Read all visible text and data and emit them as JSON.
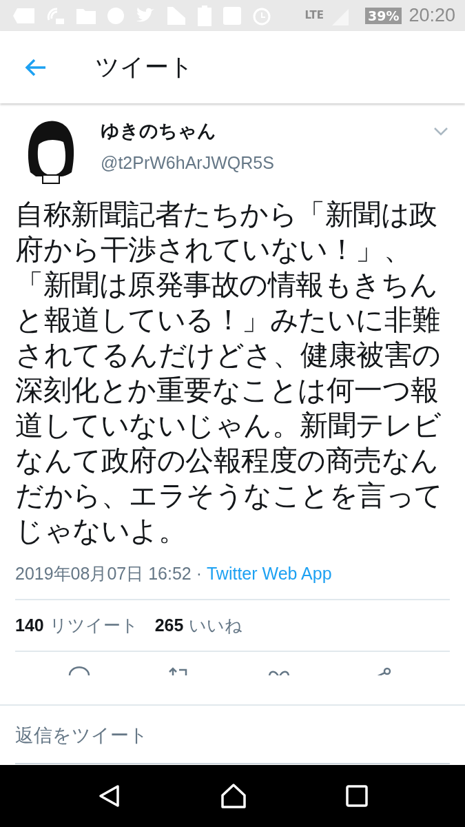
{
  "status_bar": {
    "network": "LTE",
    "battery": "39%",
    "time": "20:20"
  },
  "header": {
    "title": "ツイート"
  },
  "tweet": {
    "name": "ゆきのちゃん",
    "handle": "@t2PrW6hArJWQR5S",
    "text": "自称新聞記者たちから「新聞は政府から干渉されていない！」、「新聞は原発事故の情報もきちんと報道している！」みたいに非難されてるんだけどさ、健康被害の深刻化とか重要なことは何一つ報道していないじゃん。新聞テレビなんて政府の公報程度の商売なんだから、エラそうなことを言ってじゃないよ。",
    "timestamp": "2019年08月07日 16:52 · ",
    "source": "Twitter Web App",
    "stats": [
      {
        "count": "140",
        "label": "リツイート"
      },
      {
        "count": "265",
        "label": "いいね"
      }
    ]
  },
  "reply": {
    "placeholder": "返信をツイート"
  }
}
